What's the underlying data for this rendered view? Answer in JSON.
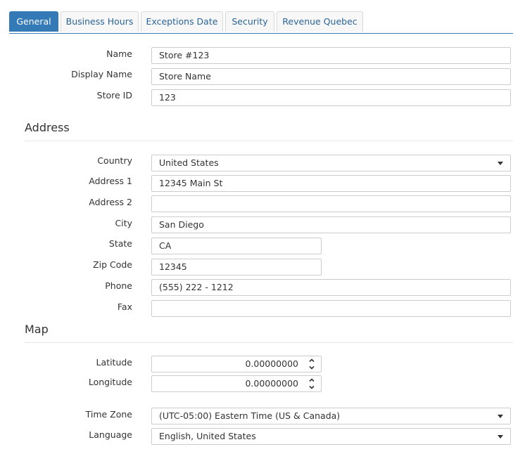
{
  "tabs": [
    "General",
    "Business Hours",
    "Exceptions Date",
    "Security",
    "Revenue Quebec"
  ],
  "general": {
    "name_label": "Name",
    "name_value": "Store #123",
    "display_name_label": "Display Name",
    "display_name_value": "Store Name",
    "store_id_label": "Store ID",
    "store_id_value": "123"
  },
  "address": {
    "title": "Address",
    "country_label": "Country",
    "country_value": "United States",
    "address1_label": "Address 1",
    "address1_value": "12345 Main St",
    "address2_label": "Address 2",
    "address2_value": "",
    "city_label": "City",
    "city_value": "San Diego",
    "state_label": "State",
    "state_value": "CA",
    "zip_label": "Zip Code",
    "zip_value": "12345",
    "phone_label": "Phone",
    "phone_value": "(555) 222 - 1212",
    "fax_label": "Fax",
    "fax_value": ""
  },
  "map": {
    "title": "Map",
    "latitude_label": "Latitude",
    "latitude_value": "0.00000000",
    "longitude_label": "Longitude",
    "longitude_value": "0.00000000"
  },
  "settings": {
    "timezone_label": "Time Zone",
    "timezone_value": "(UTC-05:00) Eastern Time (US & Canada)",
    "language_label": "Language",
    "language_value": "English, United States"
  },
  "colors": {
    "accent": "#337ab7",
    "tab_text": "#2a6496",
    "border": "#cccccc"
  }
}
